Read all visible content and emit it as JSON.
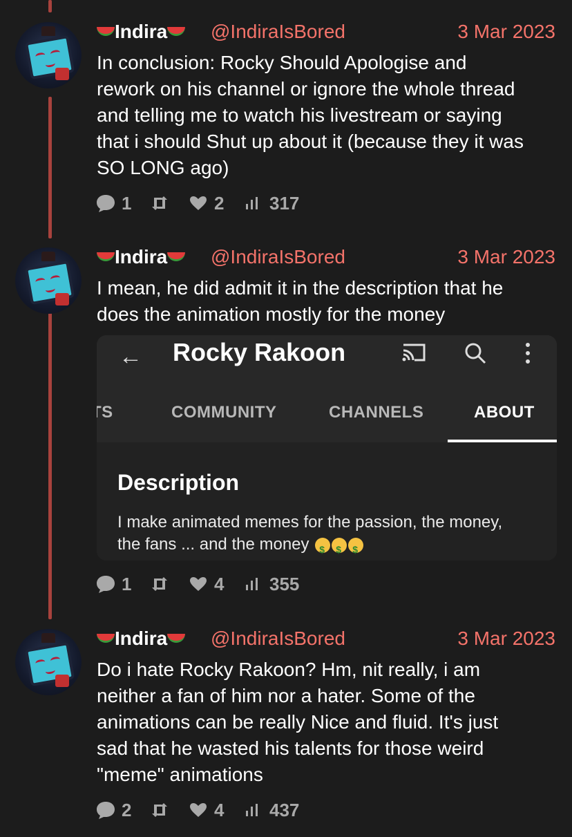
{
  "tweets": [
    {
      "name": "Indira",
      "handle": "@IndiraIsBored",
      "date": "3 Mar 2023",
      "lines": [
        "In conclusion: Rocky Should Apologise and",
        "rework on his channel or ignore the whole thread",
        "and telling me to watch his livestream or saying",
        "that i should Shut up about it (because they it was",
        "SO LONG ago)"
      ],
      "replies": "1",
      "retweets": "",
      "likes": "2",
      "views": "317"
    },
    {
      "name": "Indira",
      "handle": "@IndiraIsBored",
      "date": "3 Mar 2023",
      "lines": [
        "I mean, he did admit it in the description that he",
        "does the animation mostly for the money"
      ],
      "replies": "1",
      "retweets": "",
      "likes": "4",
      "views": "355"
    },
    {
      "name": "Indira",
      "handle": "@IndiraIsBored",
      "date": "3 Mar 2023",
      "lines": [
        "Do i hate Rocky Rakoon? Hm, nit really, i am",
        "neither a fan of him nor a hater. Some of the",
        "animations can be really Nice and fluid. It's just",
        "sad that he wasted his talents for those weird",
        "\"meme\" animations"
      ],
      "replies": "2",
      "retweets": "",
      "likes": "4",
      "views": "437"
    }
  ],
  "embed": {
    "back_arrow": "←",
    "channel_title": "Rocky Rakoon",
    "tabs": [
      "TS",
      "COMMUNITY",
      "CHANNELS",
      "ABOUT"
    ],
    "active_tab": "ABOUT",
    "description_heading": "Description",
    "description_line1": "I make animated memes for the passion, the money,",
    "description_line2": "the fans ... and the money",
    "icons": [
      "cast-icon",
      "search-icon",
      "more-vert-icon"
    ]
  },
  "colors": {
    "background": "#1c1c1c",
    "accent": "#f4736a",
    "thread_line": "#a8423d",
    "stats": "#a9a9a9"
  }
}
